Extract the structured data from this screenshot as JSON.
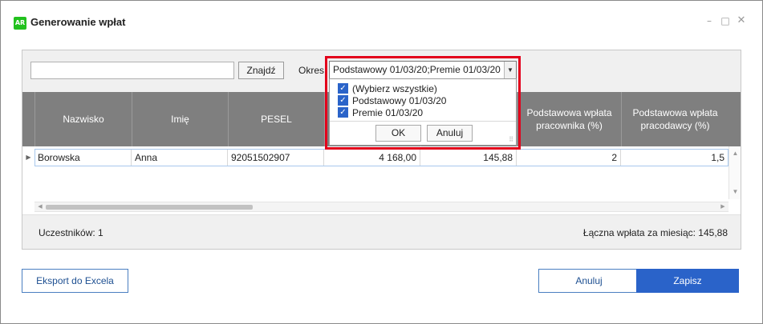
{
  "window": {
    "title": "Generowanie wpłat",
    "app_icon_text": "AR"
  },
  "toolbar": {
    "search": {
      "value": "",
      "placeholder": ""
    },
    "find_label": "Znajdź",
    "period_label": "Okres:",
    "period_value": "Podstawowy 01/03/20;Premie 01/03/20"
  },
  "dropdown": {
    "options": [
      {
        "label": "(Wybierz wszystkie)",
        "checked": true
      },
      {
        "label": "Podstawowy 01/03/20",
        "checked": true
      },
      {
        "label": "Premie 01/03/20",
        "checked": true
      }
    ],
    "ok_label": "OK",
    "cancel_label": "Anuluj"
  },
  "grid": {
    "columns": [
      "Nazwisko",
      "Imię",
      "PESEL",
      "",
      "",
      "Podstawowa wpłata pracownika (%)",
      "Podstawowa wpłata pracodawcy (%)"
    ],
    "rows": [
      [
        "Borowska",
        "Anna",
        "92051502907",
        "4 168,00",
        "145,88",
        "2",
        "1,5"
      ]
    ]
  },
  "footer": {
    "participants": "Uczestników: 1",
    "total": "Łączna wpłata za miesiąc: 145,88"
  },
  "buttons": {
    "export": "Eksport do Excela",
    "cancel": "Anuluj",
    "save": "Zapisz"
  },
  "colors": {
    "header_bg": "#7f7f7f",
    "accent": "#2a63c9",
    "highlight": "#e3001b",
    "app_icon": "#22c11e"
  }
}
